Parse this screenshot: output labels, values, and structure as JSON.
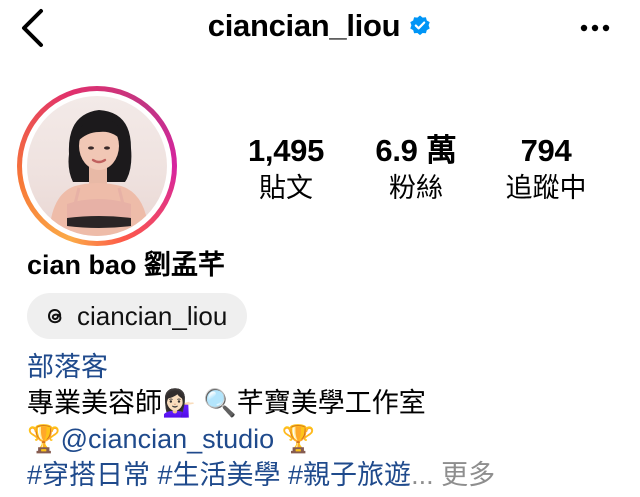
{
  "header": {
    "username": "ciancian_liou",
    "verified": true
  },
  "stats": [
    {
      "value": "1,495",
      "label": "貼文"
    },
    {
      "value": "6.9 萬",
      "label": "粉絲"
    },
    {
      "value": "794",
      "label": "追蹤中"
    }
  ],
  "profile": {
    "display_name": "cian bao 劉孟芊"
  },
  "threads": {
    "handle": "ciancian_liou"
  },
  "bio": {
    "category": "部落客",
    "line1_text": "專業美容師",
    "line1_emoji": "💁🏻‍♀️",
    "line1_search_emoji": "🔍",
    "line1_studio": "芊寶美學工作室",
    "line2_emoji_left": "🏆",
    "line2_mention": "@ciancian_studio",
    "line2_emoji_right": "🏆",
    "line3_hashtags": "#穿搭日常 #生活美學 #親子旅遊",
    "line3_ellipsis": "...",
    "more_label": "更多"
  },
  "colors": {
    "link_blue": "#1f4a8c",
    "verified_blue": "#0095f6",
    "more_gray": "#8e8e8e"
  }
}
